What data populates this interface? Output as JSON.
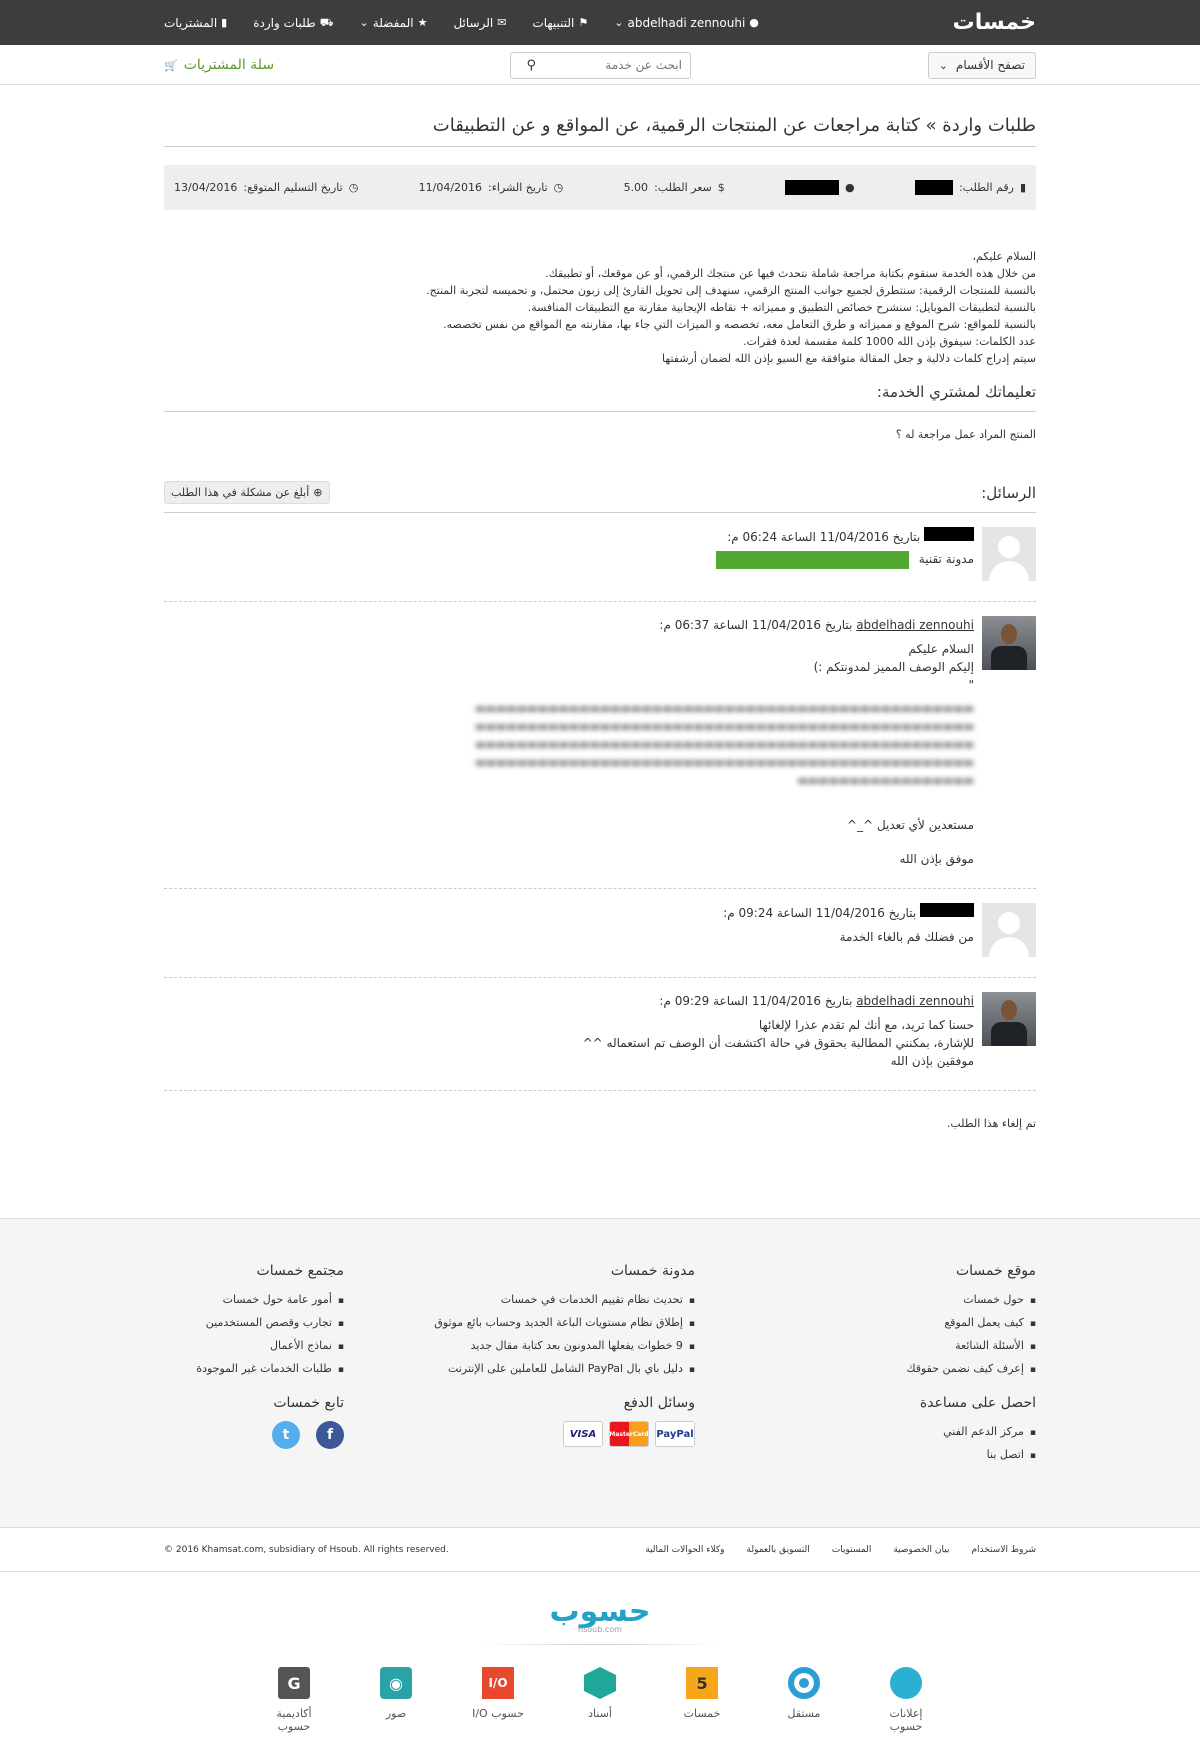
{
  "header": {
    "logo": "خمسات",
    "nav": [
      {
        "label": "abdelhadi zennouhi",
        "icon": "user-icon"
      },
      {
        "label": "التنبيهات",
        "icon": "flag-icon"
      },
      {
        "label": "الرسائل",
        "icon": "envelope-icon"
      },
      {
        "label": "المفضلة",
        "icon": "star-icon"
      },
      {
        "label": "طلبات واردة",
        "icon": "truck-icon"
      },
      {
        "label": "المشتريات",
        "icon": "folder-icon"
      }
    ]
  },
  "subbar": {
    "browse_label": "تصفح الأقسام",
    "search_placeholder": "ابحث عن خدمة",
    "cart_label": "سلة المشتريات"
  },
  "order": {
    "title": "طلبات واردة » كتابة مراجعات عن المنتجات الرقمية، عن المواقع و عن التطبيقات",
    "order_no_label": "رقم الطلب:",
    "price_label": "سعر الطلب:",
    "price": "5.00",
    "purchase_date_label": "تاريخ الشراء:",
    "purchase_date": "11/04/2016",
    "delivery_label": "تاريخ التسليم المتوقع:",
    "delivery_date": "13/04/2016"
  },
  "description": [
    "السلام عليكم،",
    "من خلال هذه الخدمة سنقوم بكتابة مراجعة شاملة نتحدث فيها عن منتجك الرقمي، أو عن موقعك، أو تطبيقك.",
    "بالنسبة للمنتجات الرقمية: سنتطرق لجميع جوانب المنتج الرقمي، سنهدف إلى تحويل القارئ إلى زبون محتمل، و تحميسه لتجربة المنتج.",
    "بالنسبة لتطبيقات الموبايل: سنشرح خصائص التطبيق و مميزاته + نقاطه الإيجابية مقارنة مع التطبيقات المنافسة.",
    "بالنسبة للمواقع: شرح الموقع و مميزاته و طرق التعامل معه، تخصصه و الميزات التي جاء بها، مقارنته مع المواقع من نفس تخصصه.",
    "عدد الكلمات: سيفوق بإذن الله 1000 كلمة مقسمة لعدة فقرات.",
    "سيتم إدراج كلمات دلالية و جعل المقالة متوافقة مع السيو بإذن الله لضمان أرشفتها"
  ],
  "instructions": {
    "title": "تعليماتك لمشتري الخدمة:",
    "text": "المنتج المراد عمل مراجعة له ؟"
  },
  "messages": {
    "title": "الرسائل:",
    "report_label": "أبلغ عن مشكلة في هذا الطلب",
    "items": [
      {
        "author": "",
        "meta": "بتاريخ 11/04/2016 الساعة 06:24 م:",
        "lines": [
          "مدونة تقنية"
        ]
      },
      {
        "author": "abdelhadi zennouhi",
        "meta": "بتاريخ 11/04/2016 الساعة 06:37 م:",
        "lines": [
          "السلام عليكم",
          "إليكم الوصف المميز لمدونتكم :)",
          "\""
        ],
        "extra": [
          "مستعدين لأي تعديل ^_^",
          "موفق بإذن الله"
        ]
      },
      {
        "author": "",
        "meta": "بتاريخ 11/04/2016 الساعة 09:24 م:",
        "lines": [
          "من فضلك قم بالغاء الخدمة"
        ]
      },
      {
        "author": "abdelhadi zennouhi",
        "meta": "بتاريخ 11/04/2016 الساعة 09:29 م:",
        "lines": [
          "حسنا كما تريد، مع أنك لم تقدم عذرا لإلغائها",
          "للإشارة، بمكنني المطالبة بحقوق في حالة اكتشفت أن الوصف تم استعماله ^^",
          "موفقين بإذن الله"
        ]
      }
    ],
    "cancelled": "تم إلغاء هذا الطلب."
  },
  "footer": {
    "col1": {
      "title": "موقع خمسات",
      "items": [
        "حول خمسات",
        "كيف يعمل الموقع",
        "الأسئلة الشائعة",
        "إعرف كيف نضمن حقوقك"
      ]
    },
    "col2": {
      "title": "مدونة خمسات",
      "items": [
        "تحديث نظام تقييم الخدمات في خمسات",
        "إطلاق نظام مستويات الباعة الجديد وحساب بائع موثوق",
        "9 خطوات يفعلها المدونون بعد كتابة مقال جديد",
        "دليل باي بال PayPal الشامل للعاملين على الإنترنت"
      ]
    },
    "col3": {
      "title": "مجتمع خمسات",
      "items": [
        "أمور عامة حول خمسات",
        "تجارب وقصص المستخدمين",
        "نماذج الأعمال",
        "طلبات الخدمات غير الموجودة"
      ]
    },
    "help": {
      "title": "احصل على مساعدة",
      "items": [
        "مركز الدعم الفني",
        "اتصل بنا"
      ]
    },
    "payment": {
      "title": "وسائل الدفع",
      "methods": [
        "PayPal",
        "MasterCard",
        "VISA"
      ]
    },
    "follow": {
      "title": "تابع خمسات",
      "networks": [
        "f",
        "t"
      ]
    }
  },
  "legal": {
    "links": [
      "شروط الاستخدام",
      "بيان الخصوصية",
      "المستويات",
      "التسويق بالعمولة",
      "وكلاء الحوالات المالية"
    ],
    "copyright": "© 2016 Khamsat.com, subsidiary of Hsoub. All rights reserved."
  },
  "hsoub": {
    "logo": "حسوب",
    "sub": "hsoub.com",
    "products": [
      "إعلانات حسوب",
      "مستقل",
      "خمسات",
      "أسناد",
      "حسوب I/O",
      "صور",
      "أكاديمية حسوب"
    ]
  }
}
